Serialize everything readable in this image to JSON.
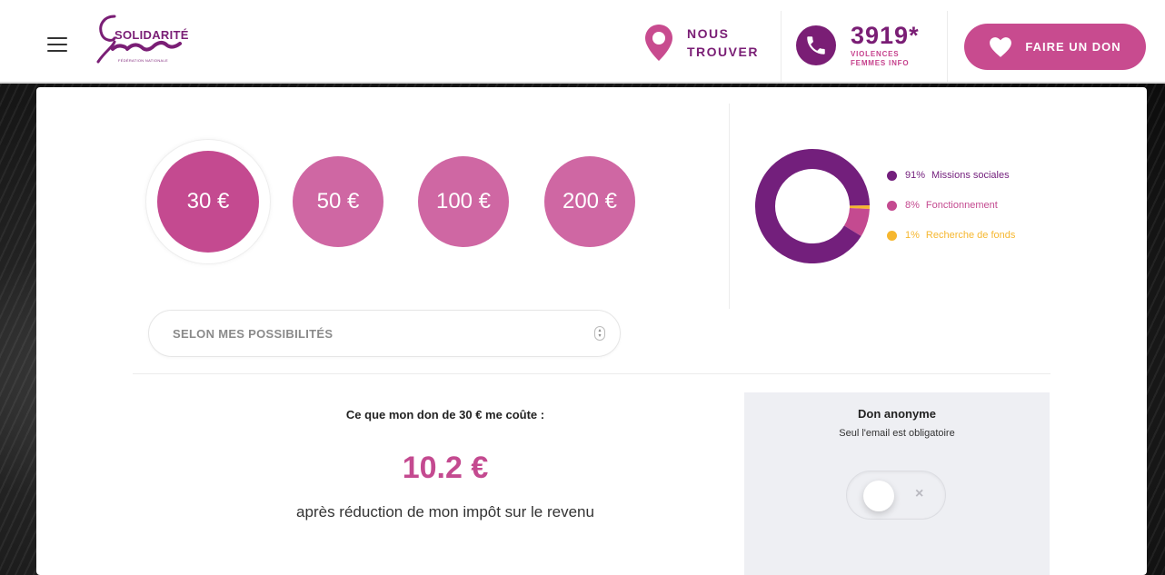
{
  "header": {
    "logo_top": "SOLIDARITÉ",
    "logo_bottom": "Femmes",
    "logo_small": "FÉDÉRATION NATIONALE",
    "find_us_line1": "NOUS",
    "find_us_line2": "TROUVER",
    "hotline_number": "3919*",
    "hotline_line1": "VIOLENCES",
    "hotline_line2": "FEMMES INFO",
    "donate_label": "FAIRE UN DON"
  },
  "amounts": {
    "a30": "30 €",
    "a50": "50 €",
    "a100": "100 €",
    "a200": "200 €",
    "selected": "30 €"
  },
  "custom_amount": {
    "placeholder": "SELON MES POSSIBILITÉS"
  },
  "chart_data": {
    "type": "pie",
    "donut": true,
    "categories": [
      "Missions sociales",
      "Fonctionnement",
      "Recherche de fonds"
    ],
    "values": [
      91,
      8,
      1
    ],
    "labels": [
      "91%",
      "8%",
      "1%"
    ],
    "colors": [
      "#731f7c",
      "#c44a90",
      "#f6b72f"
    ],
    "legend": "right"
  },
  "cost": {
    "title": "Ce que mon don de 30 € me coûte :",
    "value": "10.2 €",
    "after": "après réduction de mon impôt sur le revenu"
  },
  "anonymous": {
    "title": "Don anonyme",
    "subtitle": "Seul l'email est obligatoire",
    "toggle_off_glyph": "×"
  },
  "colors": {
    "brand_purple": "#7a1e75",
    "brand_pink": "#c84b8f",
    "amount_pink": "#cf67a3",
    "panel_bg": "#eeeff3"
  }
}
